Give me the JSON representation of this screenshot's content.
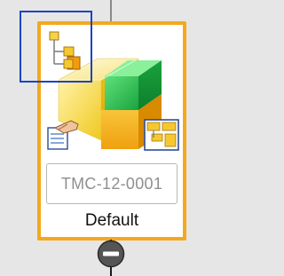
{
  "node": {
    "id_value": "TMC-12-0001",
    "label": "Default"
  },
  "icons": {
    "hierarchy": "hierarchy-icon",
    "template": "template-icon",
    "edit_hand": "edit-hand-icon",
    "layout": "layout-icon",
    "collapse": "minus-circle-icon"
  },
  "colors": {
    "card_border": "#f5a81c",
    "selection_border": "#1b44c4",
    "cube_yellow": "#f3d23a",
    "cube_green": "#22b24c"
  }
}
